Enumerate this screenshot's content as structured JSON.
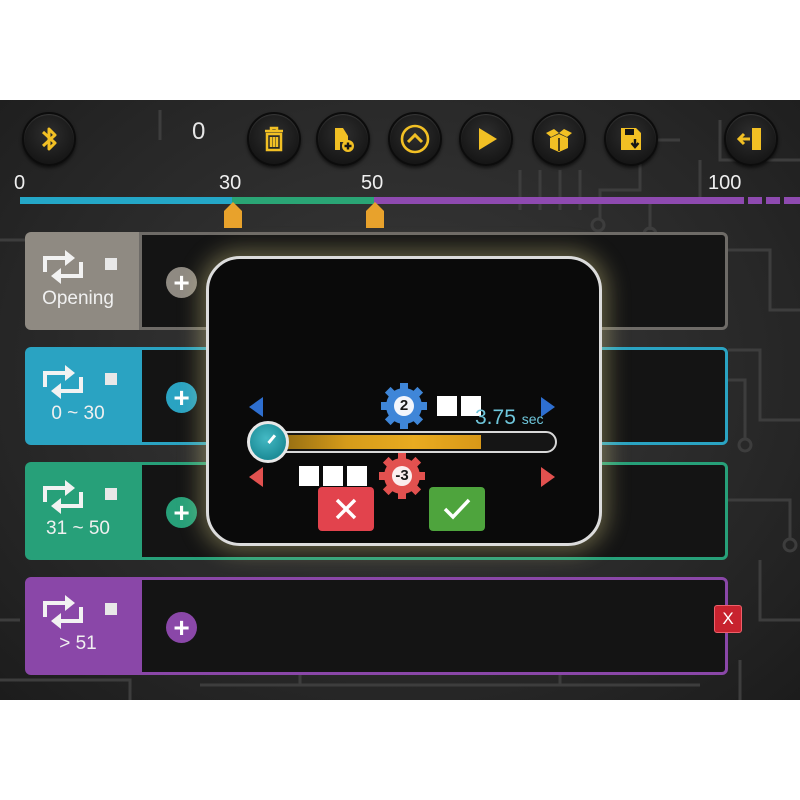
{
  "toolbar": {
    "counter": "0",
    "buttons": [
      "bluetooth-icon",
      "trash-icon",
      "add-note-icon",
      "up-icon",
      "play-icon",
      "box-icon",
      "save-icon",
      "exit-icon"
    ]
  },
  "timeline": {
    "ticks": [
      "0",
      "30",
      "50",
      "100"
    ],
    "markers": [
      30,
      50
    ],
    "colors": {
      "opening": "#24a7c7",
      "range1": "#2aa575",
      "range2": "#8e4ab0"
    }
  },
  "rows": [
    {
      "label": "Opening",
      "color": "#8f8a82"
    },
    {
      "label": "0 ~ 30",
      "color": "#2aa3c2"
    },
    {
      "label": "31 ~ 50",
      "color": "#27a079"
    },
    {
      "label": "> 51",
      "color": "#8a47a8"
    }
  ],
  "row_delete_label": "X",
  "dialog": {
    "gear_top": "2",
    "gear_bottom": "-3",
    "duration_value": "3.75",
    "duration_unit": "sec",
    "slider_level": 0.75,
    "cancel_icon": "close-icon",
    "confirm_icon": "check-icon"
  }
}
